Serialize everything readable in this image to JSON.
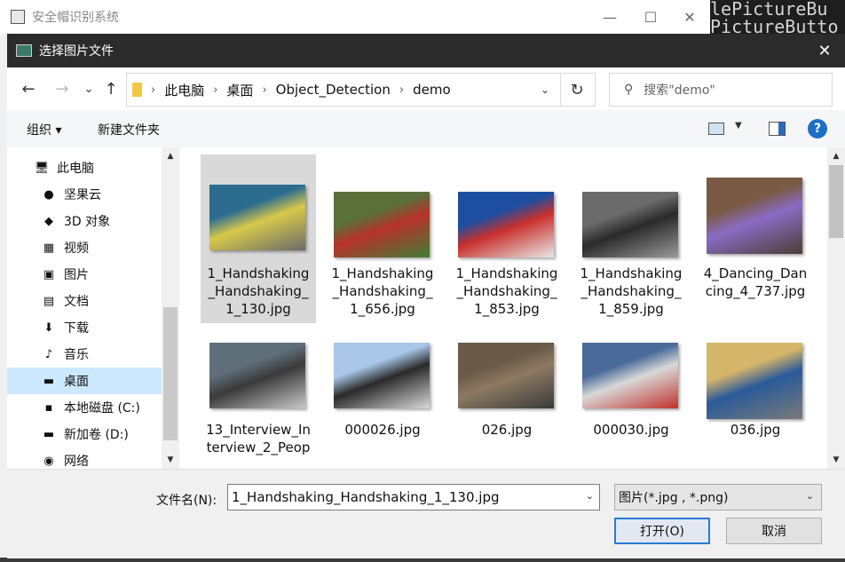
{
  "background_app": {
    "title": "安全帽识别系统",
    "minimize": "—",
    "maximize": "☐",
    "close": "✕",
    "code_lines": [
      "lePictureBu",
      "PictureButto"
    ]
  },
  "dialog": {
    "title": "选择图片文件",
    "close": "✕"
  },
  "nav_buttons": {
    "back": "←",
    "forward": "→",
    "recent": "⌄",
    "up": "↑"
  },
  "address": {
    "breadcrumbs": [
      "此电脑",
      "桌面",
      "Object_Detection",
      "demo"
    ],
    "separator": "›",
    "dropdown": "⌄",
    "refresh": "↻"
  },
  "search": {
    "icon": "⚲",
    "placeholder": "搜索\"demo\""
  },
  "toolbar": {
    "organize": "组织 ▾",
    "new_folder": "新建文件夹",
    "view_caret": "▼",
    "help": "?"
  },
  "nav_pane": {
    "items": [
      {
        "label": "此电脑",
        "icon": "computer-icon",
        "glyph": "🖥"
      },
      {
        "label": "坚果云",
        "icon": "nut-cloud-icon",
        "glyph": "●"
      },
      {
        "label": "3D 对象",
        "icon": "cube-icon",
        "glyph": "◆"
      },
      {
        "label": "视频",
        "icon": "film-icon",
        "glyph": "▦"
      },
      {
        "label": "图片",
        "icon": "picture-icon",
        "glyph": "▣"
      },
      {
        "label": "文档",
        "icon": "document-icon",
        "glyph": "▤"
      },
      {
        "label": "下载",
        "icon": "download-icon",
        "glyph": "⬇"
      },
      {
        "label": "音乐",
        "icon": "music-icon",
        "glyph": "♪"
      },
      {
        "label": "桌面",
        "icon": "desktop-icon",
        "glyph": "▬"
      },
      {
        "label": "本地磁盘 (C:)",
        "icon": "windows-drive-icon",
        "glyph": "▪"
      },
      {
        "label": "新加卷 (D:)",
        "icon": "drive-icon",
        "glyph": "▬"
      },
      {
        "label": "网络",
        "icon": "network-icon",
        "glyph": "◉"
      }
    ],
    "selected_index": 8,
    "scroll_up": "▲",
    "scroll_down": "▼"
  },
  "files": [
    {
      "name": "1_Handshaking_Handshaking_1_130.jpg",
      "label_lines": [
        "1_Handshaking",
        "_Handshaking_",
        "1_130.jpg"
      ],
      "selected": true,
      "thumb_colors": [
        "#2b6c8f",
        "#d7c94a",
        "#6a6a6a"
      ]
    },
    {
      "name": "1_Handshaking_Handshaking_1_656.jpg",
      "label_lines": [
        "1_Handshaking",
        "_Handshaking_",
        "1_656.jpg"
      ],
      "selected": false,
      "thumb_colors": [
        "#5a6f3a",
        "#b8322a",
        "#3f7d35"
      ]
    },
    {
      "name": "1_Handshaking_Handshaking_1_853.jpg",
      "label_lines": [
        "1_Handshaking",
        "_Handshaking_",
        "1_853.jpg"
      ],
      "selected": false,
      "thumb_colors": [
        "#1d4ea0",
        "#c8302c",
        "#e8e8e8"
      ]
    },
    {
      "name": "1_Handshaking_Handshaking_1_859.jpg",
      "label_lines": [
        "1_Handshaking",
        "_Handshaking_",
        "1_859.jpg"
      ],
      "selected": false,
      "thumb_colors": [
        "#6b6b6b",
        "#2a2a2a",
        "#9a9a9a"
      ]
    },
    {
      "name": "4_Dancing_Dancing_4_737.jpg",
      "label_lines": [
        "4_Dancing_Dan",
        "cing_4_737.jpg"
      ],
      "selected": false,
      "thumb_colors": [
        "#7a5a44",
        "#8a6bc4",
        "#4a3f35"
      ]
    },
    {
      "name": "13_Interview_Interview_2_Peop",
      "label_lines": [
        "13_Interview_In",
        "terview_2_Peop"
      ],
      "selected": false,
      "thumb_colors": [
        "#5f6f7a",
        "#3a3a3a",
        "#c9c9c9"
      ]
    },
    {
      "name": "000026.jpg",
      "label_lines": [
        "000026.jpg"
      ],
      "selected": false,
      "thumb_colors": [
        "#a9c7e8",
        "#2a2a2a",
        "#d9d9d9"
      ]
    },
    {
      "name": "026.jpg",
      "label_lines": [
        "026.jpg"
      ],
      "selected": false,
      "thumb_colors": [
        "#6a5a48",
        "#8c7a62",
        "#3a3a3a"
      ]
    },
    {
      "name": "000030.jpg",
      "label_lines": [
        "000030.jpg"
      ],
      "selected": false,
      "thumb_colors": [
        "#4a6a9a",
        "#d8d8d8",
        "#c0302a"
      ]
    },
    {
      "name": "036.jpg",
      "label_lines": [
        "036.jpg"
      ],
      "selected": false,
      "thumb_colors": [
        "#d4b56a",
        "#2a5a9a",
        "#7a7a7a"
      ]
    }
  ],
  "file_scroll": {
    "up": "▲",
    "down": "▼"
  },
  "bottom": {
    "filename_label": "文件名(N):",
    "filename_value": "1_Handshaking_Handshaking_1_130.jpg",
    "filename_dropdown": "⌄",
    "filetype_value": "图片(*.jpg , *.png)",
    "filetype_dropdown": "⌄",
    "open_label": "打开(O)",
    "cancel_label": "取消"
  }
}
